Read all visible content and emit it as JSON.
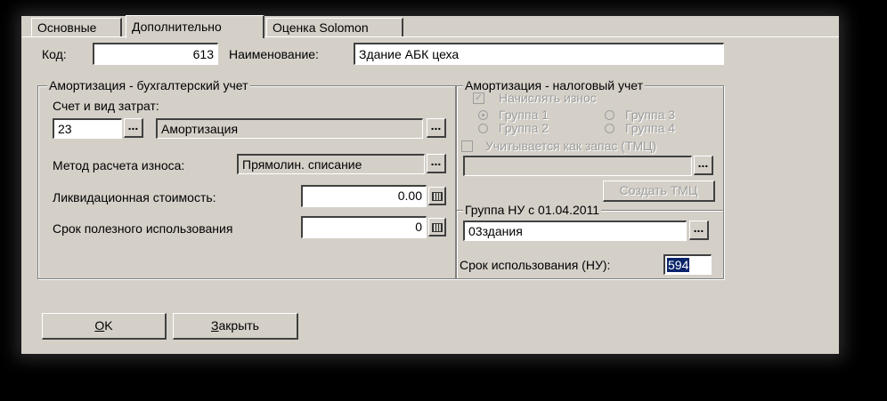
{
  "tabs": [
    {
      "label": "Основные"
    },
    {
      "label": "Дополнительно"
    },
    {
      "label": "Оценка Solomon"
    }
  ],
  "header": {
    "code_label": "Код:",
    "code_value": "613",
    "name_label": "Наименование:",
    "name_value": "Здание АБК цеха"
  },
  "accounting": {
    "legend": "Амортизация - бухгалтерский учет",
    "account_label": "Счет и вид затрат:",
    "account_value": "23",
    "cost_type_value": "Амортизация",
    "method_label": "Метод расчета износа:",
    "method_value": "Прямолин. списание",
    "liquidation_label": "Ликвидационная стоимость:",
    "liquidation_value": "0.00",
    "useful_life_label": "Срок полезного использования",
    "useful_life_value": "0"
  },
  "tax": {
    "legend": "Амортизация - налоговый учет",
    "accrue_label": "Начислять износ",
    "group1": "Группа 1",
    "group2": "Группа 2",
    "group3": "Группа 3",
    "group4": "Группа 4",
    "inventory_label": "Учитывается как запас (ТМЦ)",
    "inventory_value": "",
    "create_button": "Создать ТМЦ"
  },
  "nu_group": {
    "legend": "Группа НУ с 01.04.2011",
    "value": "03здания",
    "term_label": "Срок использования (НУ):",
    "term_value": "594"
  },
  "buttons": {
    "ok_hotkey": "O",
    "ok_rest": "K",
    "close_hotkey": "З",
    "close_rest": "акрыть"
  },
  "dots": "...",
  "checkmark": "✓",
  "icons": {
    "ellipsis": "ellipsis-icon",
    "calendar": "calendar-icon"
  }
}
